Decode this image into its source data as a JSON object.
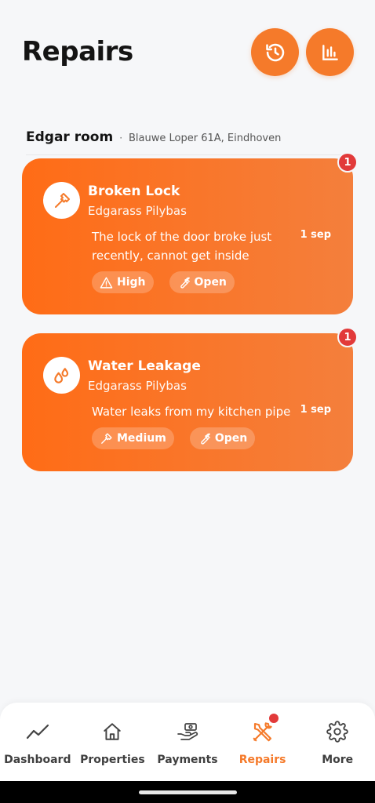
{
  "header": {
    "title": "Repairs",
    "history_icon": "history-icon",
    "stats_icon": "bar-chart-icon"
  },
  "property": {
    "name": "Edgar room",
    "separator": "·",
    "address": "Blauwe Loper 61A, Eindhoven"
  },
  "repairs": [
    {
      "title": "Broken Lock",
      "owner": "Edgarass Pilybas",
      "description": "The lock of the door broke just recently, cannot get inside",
      "date": "1 sep",
      "badge": "1",
      "icon": "hammer-icon",
      "priority": "High",
      "priority_icon": "warning-icon",
      "status": "Open",
      "status_icon": "wrench-icon"
    },
    {
      "title": "Water Leakage",
      "owner": "Edgarass Pilybas",
      "description": "Water leaks from my kitchen pipe",
      "date": "1 sep",
      "badge": "1",
      "icon": "water-drops-icon",
      "priority": "Medium",
      "priority_icon": "hammer-icon",
      "status": "Open",
      "status_icon": "wrench-icon"
    }
  ],
  "tabbar": {
    "tabs": [
      {
        "label": "Dashboard",
        "icon": "trend-line-icon"
      },
      {
        "label": "Properties",
        "icon": "house-icon"
      },
      {
        "label": "Payments",
        "icon": "hand-money-icon"
      },
      {
        "label": "Repairs",
        "icon": "tools-icon"
      },
      {
        "label": "More",
        "icon": "gear-icon"
      }
    ],
    "active_tab": "Repairs"
  },
  "colors": {
    "accent": "#f57a2a",
    "card_gradient_start": "#ff6c16",
    "card_gradient_end": "#f47f3c",
    "badge": "#e23a3a"
  }
}
